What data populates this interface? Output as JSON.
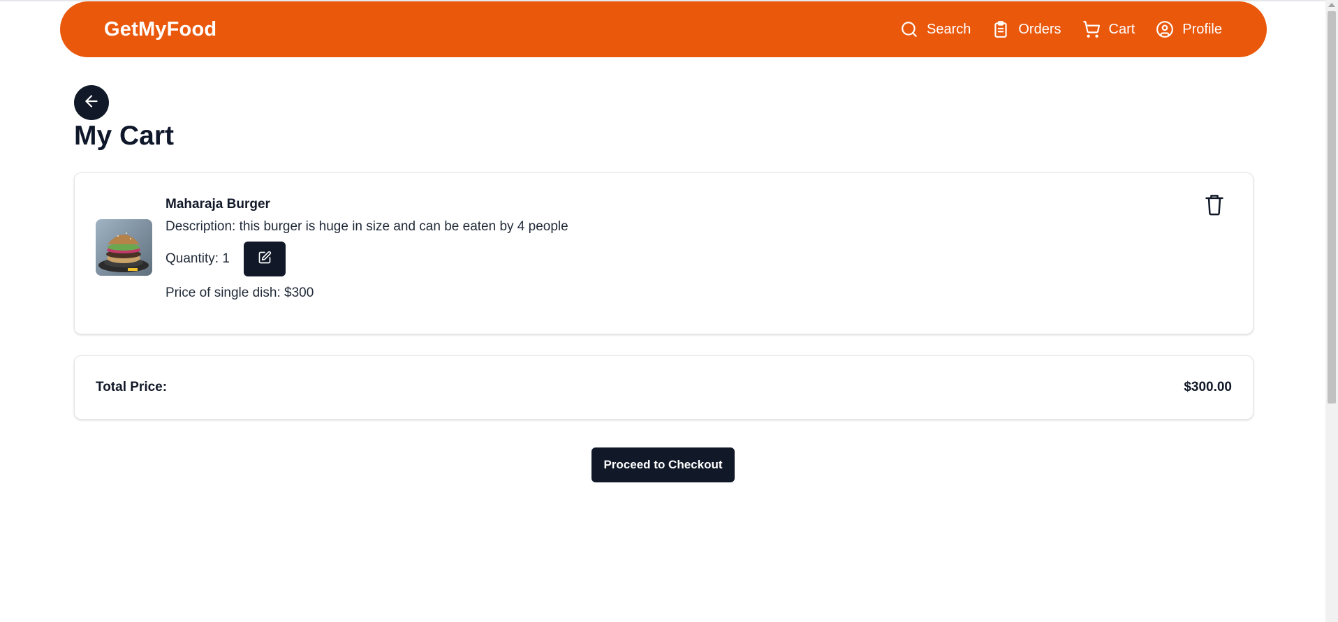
{
  "app": {
    "brand": "GetMyFood"
  },
  "nav": {
    "search": {
      "label": "Search",
      "icon": "search-icon"
    },
    "orders": {
      "label": "Orders",
      "icon": "clipboard-icon"
    },
    "cart": {
      "label": "Cart",
      "icon": "cart-icon"
    },
    "profile": {
      "label": "Profile",
      "icon": "user-circle-icon"
    }
  },
  "page": {
    "title": "My Cart"
  },
  "cart": {
    "items": [
      {
        "name": "Maharaja Burger",
        "description": "Description: this burger is huge in size and can be eaten by 4 people",
        "quantity_text": "Quantity: 1",
        "price_text": "Price of single dish: $300"
      }
    ],
    "total_label": "Total Price:",
    "total_value": "$300.00",
    "checkout_label": "Proceed to Checkout"
  },
  "colors": {
    "brand": "#ea580c",
    "dark": "#111827",
    "text": "#0f172a"
  }
}
